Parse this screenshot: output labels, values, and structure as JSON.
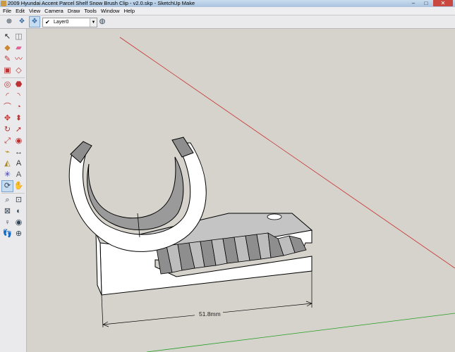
{
  "window": {
    "title": "2009 Hyundai Accent Parcel Shelf Snow Brush Clip - v2.0.skp - SketchUp Make"
  },
  "menu": {
    "items": [
      "File",
      "Edit",
      "View",
      "Camera",
      "Draw",
      "Tools",
      "Window",
      "Help"
    ]
  },
  "toolbar": {
    "layer": {
      "current": "Layer0"
    }
  },
  "tools": [
    {
      "name": "select-tool-icon",
      "glyph": "↖",
      "color": "#222"
    },
    {
      "name": "make-component-icon",
      "glyph": "◫",
      "color": "#777"
    },
    {
      "name": "paint-bucket-icon",
      "glyph": "◆",
      "color": "#c83"
    },
    {
      "name": "eraser-icon",
      "glyph": "▰",
      "color": "#d69"
    },
    {
      "name": "line-tool-icon",
      "glyph": "✎",
      "color": "#b33"
    },
    {
      "name": "freehand-tool-icon",
      "glyph": "〰",
      "color": "#b33"
    },
    {
      "name": "rectangle-tool-icon",
      "glyph": "▣",
      "color": "#b33"
    },
    {
      "name": "rotated-rectangle-icon",
      "glyph": "◇",
      "color": "#b33"
    },
    {
      "name": "circle-tool-icon",
      "glyph": "◎",
      "color": "#b33"
    },
    {
      "name": "polygon-tool-icon",
      "glyph": "⬣",
      "color": "#b33"
    },
    {
      "name": "arc-tool-icon",
      "glyph": "◜",
      "color": "#b33"
    },
    {
      "name": "two-point-arc-icon",
      "glyph": "◝",
      "color": "#b33"
    },
    {
      "name": "three-point-arc-icon",
      "glyph": "⌒",
      "color": "#b33"
    },
    {
      "name": "pie-tool-icon",
      "glyph": "◔",
      "color": "#b33"
    },
    {
      "name": "move-tool-icon",
      "glyph": "✥",
      "color": "#b33"
    },
    {
      "name": "push-pull-icon",
      "glyph": "⬍",
      "color": "#b33"
    },
    {
      "name": "rotate-tool-icon",
      "glyph": "↻",
      "color": "#b33"
    },
    {
      "name": "follow-me-icon",
      "glyph": "➚",
      "color": "#b33"
    },
    {
      "name": "scale-tool-icon",
      "glyph": "⤢",
      "color": "#b33"
    },
    {
      "name": "offset-tool-icon",
      "glyph": "◉",
      "color": "#b33"
    },
    {
      "name": "tape-measure-icon",
      "glyph": "⌁",
      "color": "#a82"
    },
    {
      "name": "dimension-tool-icon",
      "glyph": "↔",
      "color": "#333"
    },
    {
      "name": "protractor-icon",
      "glyph": "◭",
      "color": "#a82"
    },
    {
      "name": "text-tool-icon",
      "glyph": "A",
      "color": "#333"
    },
    {
      "name": "axes-tool-icon",
      "glyph": "✳",
      "color": "#33a"
    },
    {
      "name": "3d-text-icon",
      "glyph": "A",
      "color": "#555"
    },
    {
      "name": "orbit-tool-icon",
      "glyph": "⟳",
      "color": "#345"
    },
    {
      "name": "pan-tool-icon",
      "glyph": "✋",
      "color": "#345"
    },
    {
      "name": "zoom-tool-icon",
      "glyph": "⌕",
      "color": "#345"
    },
    {
      "name": "zoom-window-icon",
      "glyph": "⊡",
      "color": "#345"
    },
    {
      "name": "zoom-extents-icon",
      "glyph": "⊠",
      "color": "#345"
    },
    {
      "name": "previous-view-icon",
      "glyph": "◐",
      "color": "#345"
    },
    {
      "name": "position-camera-icon",
      "glyph": "♀",
      "color": "#345"
    },
    {
      "name": "look-around-icon",
      "glyph": "◉",
      "color": "#345"
    },
    {
      "name": "walk-tool-icon",
      "glyph": "👣",
      "color": "#345"
    },
    {
      "name": "section-plane-icon",
      "glyph": "⊕",
      "color": "#345"
    }
  ],
  "model": {
    "dimension_label": "51.8mm",
    "axis_colors": {
      "red": "#c83030",
      "green": "#22a022"
    },
    "fill_light": "#ffffff",
    "fill_mid": "#c4c4c4",
    "fill_dark": "#8e8e8e"
  }
}
